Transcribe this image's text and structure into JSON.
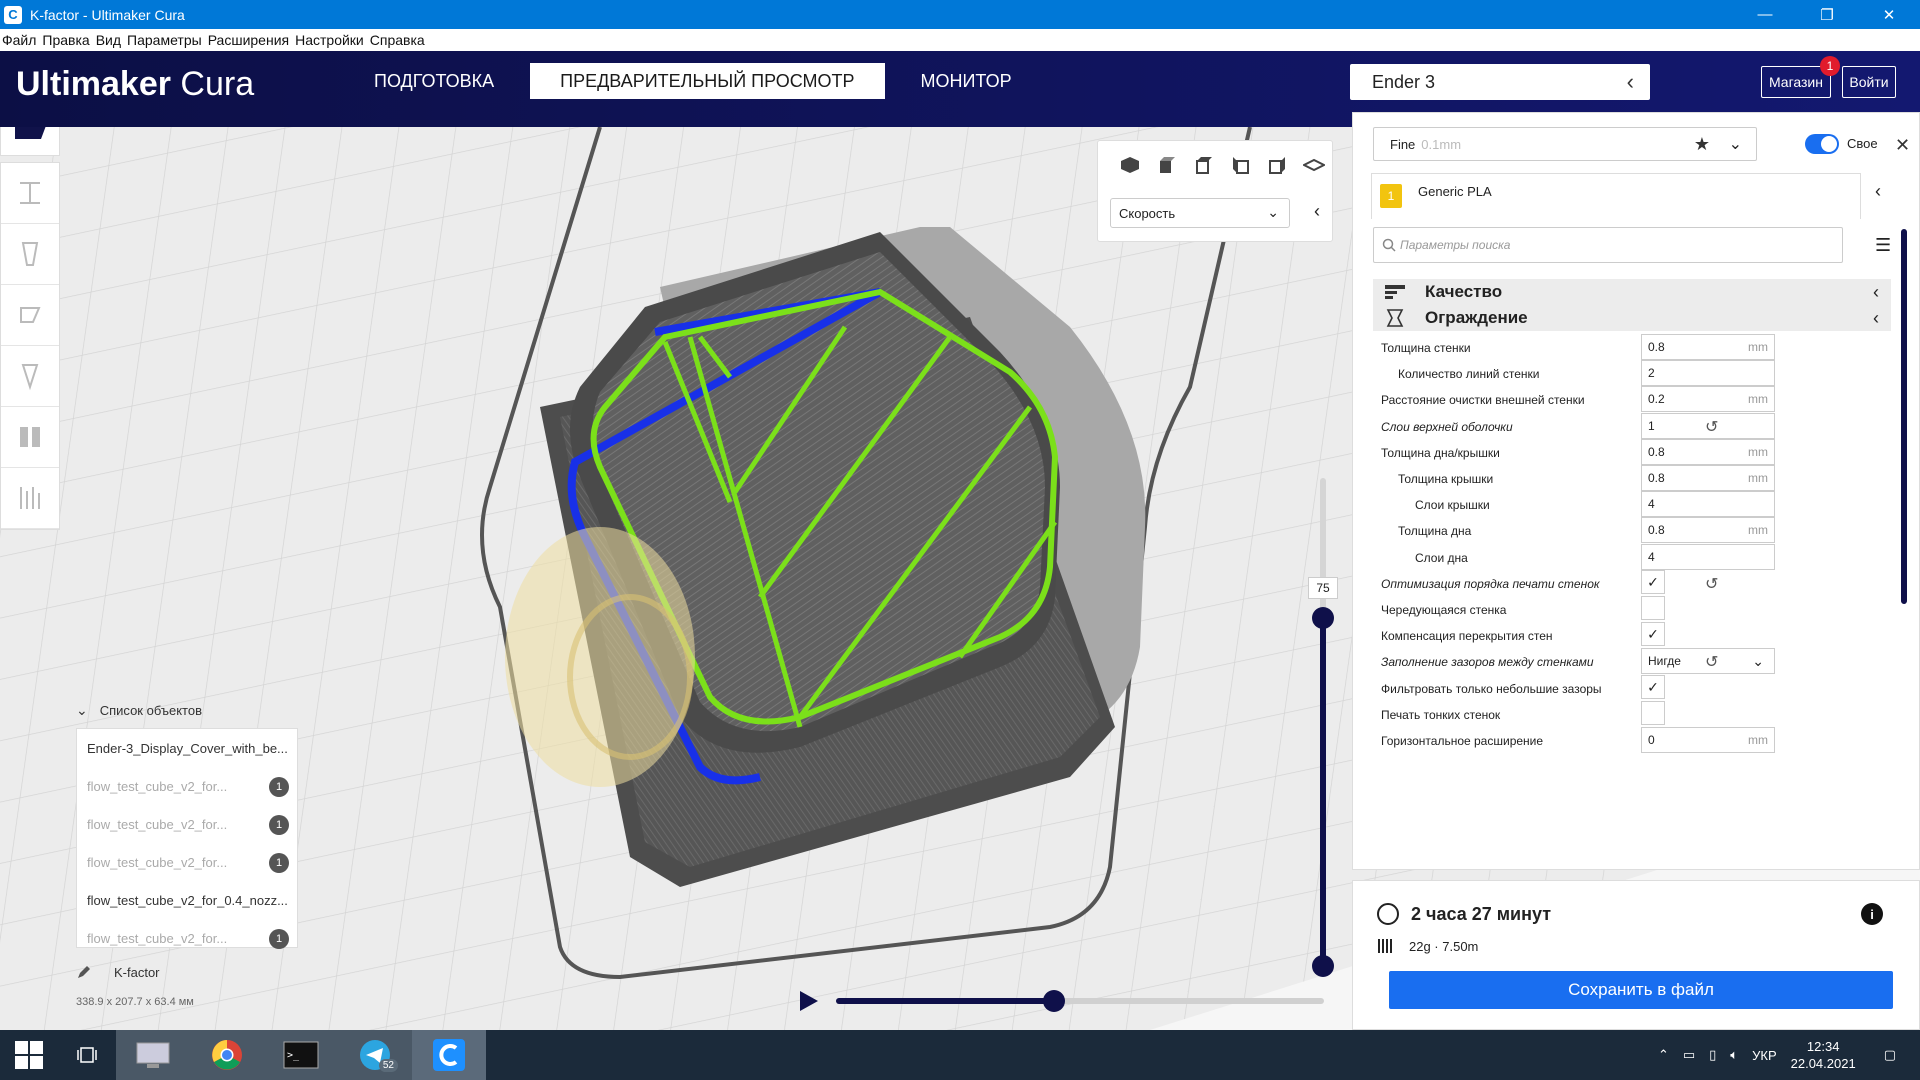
{
  "window": {
    "title": "K-factor - Ultimaker Cura",
    "controls": [
      "—",
      "❐",
      "✕"
    ]
  },
  "menu": [
    "Файл",
    "Правка",
    "Вид",
    "Параметры",
    "Расширения",
    "Настройки",
    "Справка"
  ],
  "header": {
    "logo_bold": "Ultimaker",
    "logo_light": "Cura",
    "tabs": [
      "ПОДГОТОВКА",
      "ПРЕДВАРИТЕЛЬНЫЙ ПРОСМОТР",
      "МОНИТОР"
    ],
    "active_tab": 1,
    "printer": "Ender 3",
    "market_label": "Магазин",
    "market_badge": "1",
    "login_label": "Войти"
  },
  "view_panel": {
    "color_scheme": "Скорость"
  },
  "layer_slider": {
    "value": "75"
  },
  "objects": {
    "header": "Список объектов",
    "items": [
      {
        "name": "Ender-3_Display_Cover_with_be...",
        "dim": false,
        "badge": ""
      },
      {
        "name": "flow_test_cube_v2_for...",
        "dim": true,
        "badge": "1"
      },
      {
        "name": "flow_test_cube_v2_for...",
        "dim": true,
        "badge": "1"
      },
      {
        "name": "flow_test_cube_v2_for...",
        "dim": true,
        "badge": "1"
      },
      {
        "name": "flow_test_cube_v2_for_0.4_nozz...",
        "dim": false,
        "badge": ""
      },
      {
        "name": "flow_test_cube_v2_for...",
        "dim": true,
        "badge": "1"
      }
    ],
    "job_name": "K-factor",
    "dimensions": "338.9 x 207.7 x 63.4 мм"
  },
  "settings": {
    "profile": "Fine",
    "layer_height": "0.1mm",
    "custom_label": "Свое",
    "extruder_number": "1",
    "material": "Generic PLA",
    "search_placeholder": "Параметры поиска",
    "categories": [
      "Качество",
      "Ограждение"
    ],
    "rows": [
      {
        "label": "Толщина стенки",
        "indent": 0,
        "type": "num",
        "value": "0.8",
        "unit": "mm",
        "italic": false,
        "reset": false
      },
      {
        "label": "Количество линий стенки",
        "indent": 1,
        "type": "num",
        "value": "2",
        "unit": "",
        "italic": false,
        "reset": false
      },
      {
        "label": "Расстояние очистки внешней стенки",
        "indent": 0,
        "type": "num",
        "value": "0.2",
        "unit": "mm",
        "italic": false,
        "reset": false
      },
      {
        "label": "Слои верхней оболочки",
        "indent": 0,
        "type": "num",
        "value": "1",
        "unit": "",
        "italic": true,
        "reset": true
      },
      {
        "label": "Толщина дна/крышки",
        "indent": 0,
        "type": "num",
        "value": "0.8",
        "unit": "mm",
        "italic": false,
        "reset": false
      },
      {
        "label": "Толщина крышки",
        "indent": 1,
        "type": "num",
        "value": "0.8",
        "unit": "mm",
        "italic": false,
        "reset": false
      },
      {
        "label": "Слои крышки",
        "indent": 2,
        "type": "num",
        "value": "4",
        "unit": "",
        "italic": false,
        "reset": false
      },
      {
        "label": "Толщина дна",
        "indent": 1,
        "type": "num",
        "value": "0.8",
        "unit": "mm",
        "italic": false,
        "reset": false
      },
      {
        "label": "Слои дна",
        "indent": 2,
        "type": "num",
        "value": "4",
        "unit": "",
        "italic": false,
        "reset": false
      },
      {
        "label": "Оптимизация порядка печати стенок",
        "indent": 0,
        "type": "check",
        "value": "✓",
        "unit": "",
        "italic": true,
        "reset": true
      },
      {
        "label": "Чередующаяся стенка",
        "indent": 0,
        "type": "check",
        "value": "",
        "unit": "",
        "italic": false,
        "reset": false
      },
      {
        "label": "Компенсация перекрытия стен",
        "indent": 0,
        "type": "check",
        "value": "✓",
        "unit": "",
        "italic": false,
        "reset": false
      },
      {
        "label": "Заполнение зазоров между стенками",
        "indent": 0,
        "type": "select",
        "value": "Нигде",
        "unit": "",
        "italic": true,
        "reset": true
      },
      {
        "label": "Фильтровать только небольшие зазоры",
        "indent": 0,
        "type": "check",
        "value": "✓",
        "unit": "",
        "italic": false,
        "reset": false
      },
      {
        "label": "Печать тонких стенок",
        "indent": 0,
        "type": "check",
        "value": "",
        "unit": "",
        "italic": false,
        "reset": false
      },
      {
        "label": "Горизонтальное расширение",
        "indent": 0,
        "type": "num",
        "value": "0",
        "unit": "mm",
        "italic": false,
        "reset": false
      }
    ]
  },
  "estimate": {
    "time": "2 часа 27 минут",
    "material": "22g · 7.50m",
    "save_label": "Сохранить в файл"
  },
  "taskbar": {
    "telegram_count": "52",
    "language": "УКР",
    "time": "12:34",
    "date": "22.04.2021"
  },
  "colors": {
    "header_bg": "#10124a",
    "accent": "#196ef0",
    "wall_outer": "#1020e0",
    "wall_inner": "#7be01a",
    "model_gray": "#5a5a5a"
  }
}
